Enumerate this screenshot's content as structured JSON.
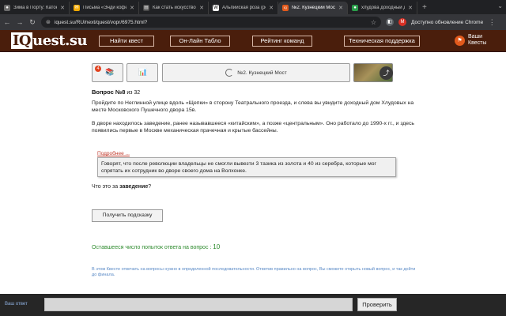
{
  "browser": {
    "tabs": [
      {
        "title": "Зима в Порту: Каток у",
        "icon": "globe-icon",
        "color": "#6b6b6b",
        "glyph": "●"
      },
      {
        "title": "Письма «Энди кофе_»",
        "icon": "mail-icon",
        "color": "#f2a900",
        "glyph": "✉"
      },
      {
        "title": "Как стать искусствове",
        "icon": "doc-icon",
        "color": "#4a4a4a",
        "glyph": "▤"
      },
      {
        "title": "Альпийская роза (рес",
        "icon": "w-icon",
        "color": "#ffffff",
        "glyph": "W"
      },
      {
        "title": "№2. Кузнецкий Мост",
        "icon": "iq-icon",
        "color": "#e25a1c",
        "glyph": "IQ"
      },
      {
        "title": "хлудова доходный д",
        "icon": "pin-icon",
        "color": "#2a9d4a",
        "glyph": "●"
      }
    ],
    "new_tab": "+",
    "url": "iquest.su/RU/next/quest/vopr/6975.html?",
    "profile_badge": "M",
    "update_label": "Доступно обновление Chrome"
  },
  "site": {
    "logo_iq": "IQ",
    "logo_rest": "uest.su",
    "nav": [
      "Найти квест",
      "Он-Лайн Табло",
      "Рейтинг команд",
      "Техническая поддержка"
    ],
    "user_line1": "Ваши",
    "user_line2": "Квесты"
  },
  "quest": {
    "notif_count": "4",
    "title": "№2. Кузнецкий Мост",
    "question_label": "Вопрос №8",
    "question_of": " из 32",
    "paragraph1": "Пройдите по Неглинной улице вдоль «Щепки» в сторону Театрального проезда, и слева вы увидите доходный дом Хлудовых на месте Московского Пушечного двора 15в.",
    "paragraph2": "В дворе находилось заведение, ранее называвшееся «китайским», а позже «центральным». Оно работало до 1990-х гг., и здесь появились первые в Москве механическая прачечная и крытые бассейны.",
    "more_link": "Подробнее ...",
    "tooltip": "Говорят, что после революции владельцы не смогли вывезти 3 тазика из золота и 40 из серебра, которые мог спрятать их сотрудник во дворе своего дома на Волхонке.",
    "ask_prefix": "Что это за ",
    "ask_bold": "заведение",
    "ask_suffix": "?",
    "hint_button": "Получить подсказку",
    "attempts_label": "Оставшееся число попыток ответа на вопрос : ",
    "attempts_value": "10",
    "note": "В этом Квесте отвечать на вопросы нужно в определенной последовательности. Ответив правильно на вопрос, Вы сможете открыть новый вопрос, и так дойти до финала."
  },
  "answer": {
    "label": "Ваш ответ",
    "value": "",
    "placeholder": "",
    "button": "Проверить"
  }
}
